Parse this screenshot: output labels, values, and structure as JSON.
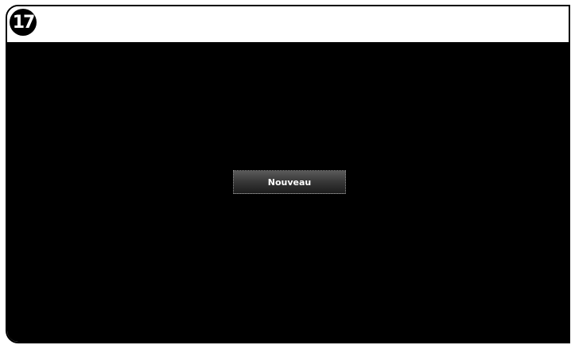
{
  "step": {
    "number": "17"
  },
  "screen": {
    "button_label": "Nouveau"
  },
  "colors": {
    "screen_background": "#000000",
    "frame_background": "#ffffff",
    "button_text": "#ffffff"
  }
}
